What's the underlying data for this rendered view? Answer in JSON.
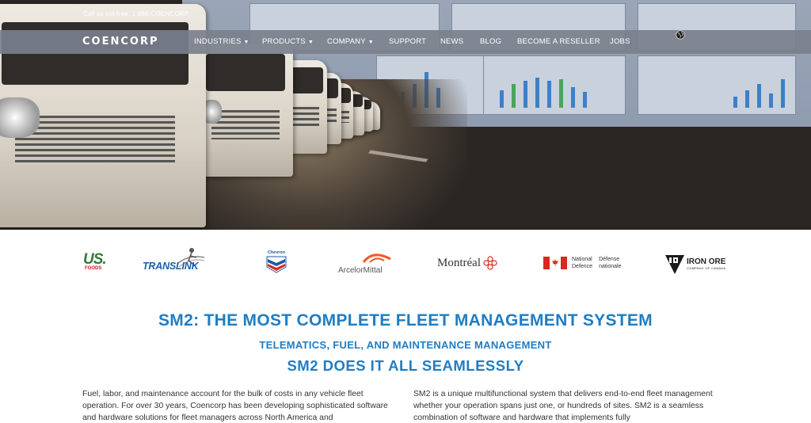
{
  "topbar": {
    "tollfree": "Call us toll-free: 1 866-COENCORP"
  },
  "brand": {
    "logo_text": "COENCORP"
  },
  "nav": {
    "items": [
      {
        "label": "INDUSTRIES",
        "has_dropdown": true
      },
      {
        "label": "PRODUCTS",
        "has_dropdown": true
      },
      {
        "label": "COMPANY",
        "has_dropdown": true
      },
      {
        "label": "SUPPORT",
        "has_dropdown": false
      },
      {
        "label": "NEWS",
        "has_dropdown": false
      },
      {
        "label": "BLOG",
        "has_dropdown": false
      },
      {
        "label": "BECOME A RESELLER",
        "has_dropdown": false
      },
      {
        "label": "JOBS",
        "has_dropdown": false
      }
    ],
    "caret": "▼",
    "language_icon": "globe-icon"
  },
  "clients": {
    "usfoods": {
      "line1": "US.",
      "line2": "FOODS"
    },
    "translink": {
      "name": "TRANSLINK"
    },
    "chevron": {
      "name": "Chevron"
    },
    "arcelormittal": {
      "name": "ArcelorMittal"
    },
    "montreal": {
      "name": "Montréal"
    },
    "national_defence": {
      "en_1": "National",
      "en_2": "Defence",
      "fr_1": "Défense",
      "fr_2": "nationale"
    },
    "iron_ore": {
      "name": "IRON ORE",
      "sub": "COMPANY OF CANADA"
    }
  },
  "headings": {
    "main": "SM2: THE MOST COMPLETE FLEET MANAGEMENT SYSTEM",
    "sub": "TELEMATICS, FUEL, AND MAINTENANCE MANAGEMENT",
    "third": "SM2 DOES IT ALL SEAMLESSLY"
  },
  "body": {
    "left": "Fuel, labor, and maintenance account for the bulk of costs in any vehicle fleet operation. For over 30 years, Coencorp has been developing sophisticated software and hardware solutions for fleet managers across North America and",
    "right": "SM2 is a unique multifunctional system that delivers end-to-end fleet management whether your operation spans just one, or hundreds of sites. SM2 is a seamless combination of software and hardware that implements fully"
  },
  "colors": {
    "heading_blue": "#1f7dc3",
    "navbar_bg": "#7a808c"
  }
}
